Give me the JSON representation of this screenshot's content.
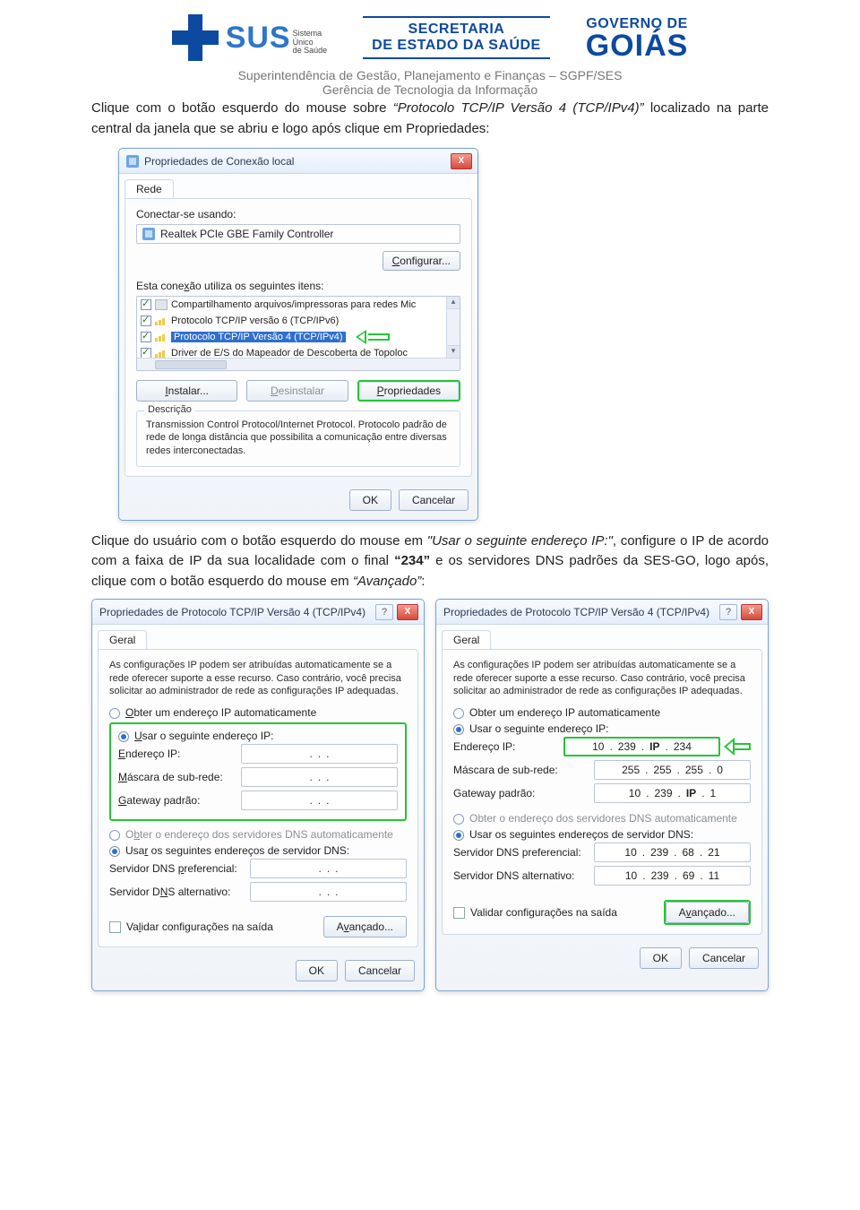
{
  "header": {
    "sus_text": "SUS",
    "sus_sub1": "Sistema",
    "sus_sub2": "Único",
    "sus_sub3": "de Saúde",
    "sec_line1": "SECRETARIA",
    "sec_line2": "DE ESTADO DA SAÚDE",
    "gov_line1": "GOVERNO DE",
    "gov_line2": "GOIÁS",
    "sup_line1": "Superintendência de Gestão, Planejamento e Finanças – SGPF/SES",
    "sup_line2": "Gerência de Tecnologia da Informação"
  },
  "intro": {
    "pre": "Clique com o botão esquerdo do mouse sobre ",
    "italic": "“Protocolo TCP/IP Versão 4 (TCP/IPv4)”",
    "post": " localizado na parte central da janela que se abriu e logo após clique em Propriedades:"
  },
  "dlg1": {
    "title": "Propriedades de Conexão local",
    "close": "X",
    "tab": "Rede",
    "connect_label": "Conectar-se usando:",
    "adapter": "Realtek PCIe GBE Family Controller",
    "configure": "Configurar...",
    "items_label": "Esta conexão utiliza os seguintes itens:",
    "items": [
      "Compartilhamento arquivos/impressoras para redes Mic",
      "Protocolo TCP/IP versão 6 (TCP/IPv6)",
      "Protocolo TCP/IP Versão 4 (TCP/IPv4)",
      "Driver de E/S do Mapeador de Descoberta de Topoloc"
    ],
    "btn_install": "Instalar...",
    "btn_uninstall": "Desinstalar",
    "btn_props": "Propriedades",
    "group_label": "Descrição",
    "desc": "Transmission Control Protocol/Internet Protocol. Protocolo padrão de rede de longa distância que possibilita a comunicação entre diversas redes interconectadas.",
    "ok": "OK",
    "cancel": "Cancelar"
  },
  "mid": {
    "p1": "Clique do usuário com o botão esquerdo do mouse em ",
    "i1": "\"Usar o seguinte endereço IP:\"",
    "p2": ", configure o IP de acordo com a faixa de IP da sua localidade com o final ",
    "b1": "“234”",
    "p3": " e os servidores DNS padrões da SES-GO, logo após, clique com o botão esquerdo do mouse em ",
    "i2": "“Avançado”",
    "p4": ":"
  },
  "tcpip": {
    "title": "Propriedades de Protocolo TCP/IP Versão 4 (TCP/IPv4)",
    "tab": "Geral",
    "explain": "As configurações IP podem ser atribuídas automaticamente se a rede oferecer suporte a esse recurso. Caso contrário, você precisa solicitar ao administrador de rede as configurações IP adequadas.",
    "r1": "Obter um endereço IP automaticamente",
    "r2": "Usar o seguinte endereço IP:",
    "l_ip": "Endereço IP:",
    "l_mask": "Máscara de sub-rede:",
    "l_gw": "Gateway padrão:",
    "r3": "Obter o endereço dos servidores DNS automaticamente",
    "r4": "Usar os seguintes endereços de servidor DNS:",
    "l_dns1": "Servidor DNS preferencial:",
    "l_dns2": "Servidor DNS alternativo:",
    "validate": "Validar configurações na saída",
    "advanced": "Avançado...",
    "ok": "OK",
    "cancel": "Cancelar"
  },
  "right": {
    "ip": [
      "10",
      "239",
      "IP",
      "234"
    ],
    "mask": [
      "255",
      "255",
      "255",
      "0"
    ],
    "gw": [
      "10",
      "239",
      "IP",
      "1"
    ],
    "dns1": [
      "10",
      "239",
      "68",
      "21"
    ],
    "dns2": [
      "10",
      "239",
      "69",
      "11"
    ]
  }
}
